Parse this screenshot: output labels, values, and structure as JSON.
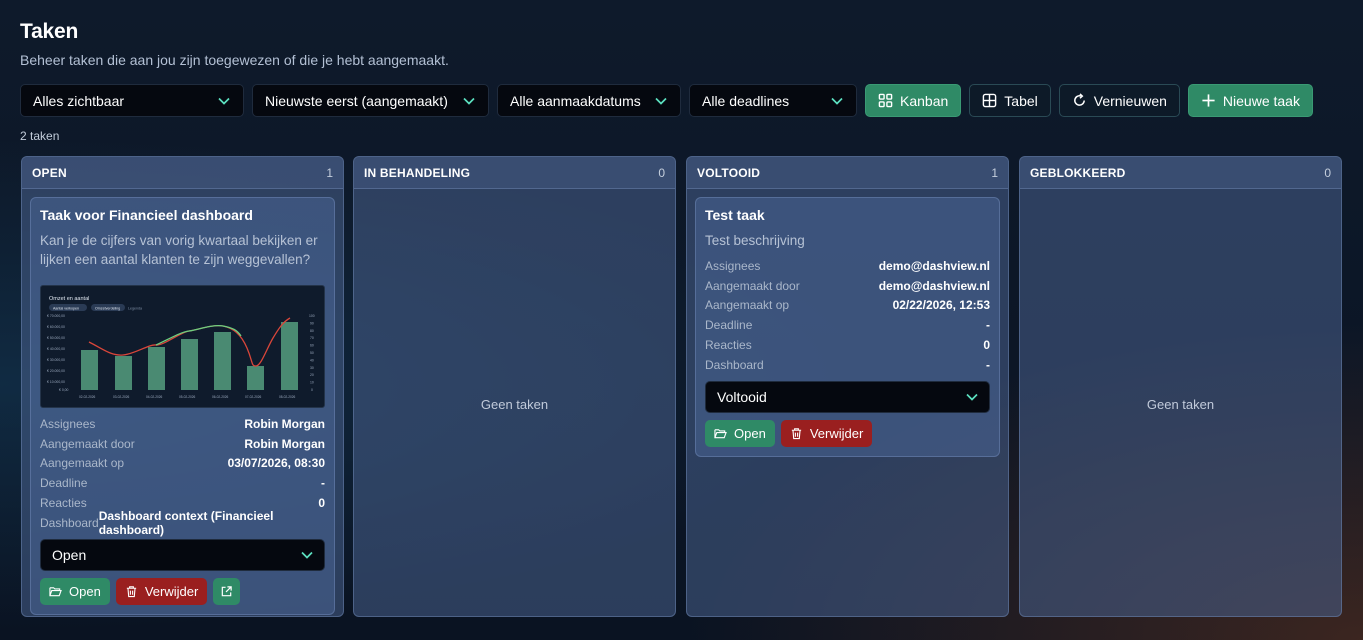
{
  "page": {
    "title": "Taken",
    "subtitle": "Beheer taken die aan jou zijn toegewezen of die je hebt aangemaakt."
  },
  "filters": {
    "visibility": "Alles zichtbaar",
    "sort": "Nieuwste eerst (aangemaakt)",
    "created": "Alle aanmaakdatums",
    "deadline": "Alle deadlines"
  },
  "buttons": {
    "kanban": "Kanban",
    "table": "Tabel",
    "refresh": "Vernieuwen",
    "new_task": "Nieuwe taak"
  },
  "task_count": "2 taken",
  "columns": [
    {
      "title": "OPEN",
      "count": "1"
    },
    {
      "title": "IN BEHANDELING",
      "count": "0",
      "empty": "Geen taken"
    },
    {
      "title": "VOLTOOID",
      "count": "1"
    },
    {
      "title": "GEBLOKKEERD",
      "count": "0",
      "empty": "Geen taken"
    }
  ],
  "labels": {
    "assignees": "Assignees",
    "created_by": "Aangemaakt door",
    "created_on": "Aangemaakt op",
    "deadline": "Deadline",
    "reactions": "Reacties",
    "dashboard": "Dashboard",
    "open": "Open",
    "delete": "Verwijder"
  },
  "cards": {
    "open": {
      "title": "Taak voor Financieel dashboard",
      "description": "Kan je de cijfers van vorig kwartaal bekijken er lijken een aantal klanten te zijn weggevallen?",
      "assignees": "Robin Morgan",
      "created_by": "Robin Morgan",
      "created_on": "03/07/2026, 08:30",
      "deadline": "-",
      "reactions": "0",
      "dashboard": "Dashboard context (Financieel dashboard)",
      "status": "Open",
      "thumbnail": {
        "title": "Omzet en aantal",
        "chips": [
          "Aantal verkopen",
          "Omzetverdeling",
          "Legenda"
        ],
        "y_ticks": [
          "€ 70.000,00",
          "€ 60.000,00",
          "€ 50.000,00",
          "€ 40.000,00",
          "€ 30.000,00",
          "€ 20.000,00",
          "€ 10.000,00",
          "€ 0,00"
        ],
        "y2_ticks": [
          "100",
          "90",
          "80",
          "70",
          "60",
          "50",
          "40",
          "30",
          "20",
          "10",
          "0"
        ],
        "x_ticks": [
          "02-02-2026",
          "03-02-2026",
          "04-02-2026",
          "05-02-2026",
          "06-02-2026",
          "07-02-2026",
          "08-02-2026"
        ]
      }
    },
    "done": {
      "title": "Test taak",
      "description": "Test beschrijving",
      "assignees": "demo@dashview.nl",
      "created_by": "demo@dashview.nl",
      "created_on": "02/22/2026, 12:53",
      "deadline": "-",
      "reactions": "0",
      "dashboard": "-",
      "status": "Voltooid"
    }
  },
  "colors": {
    "accent": "#2f8a66",
    "danger": "#9a1f1f"
  }
}
